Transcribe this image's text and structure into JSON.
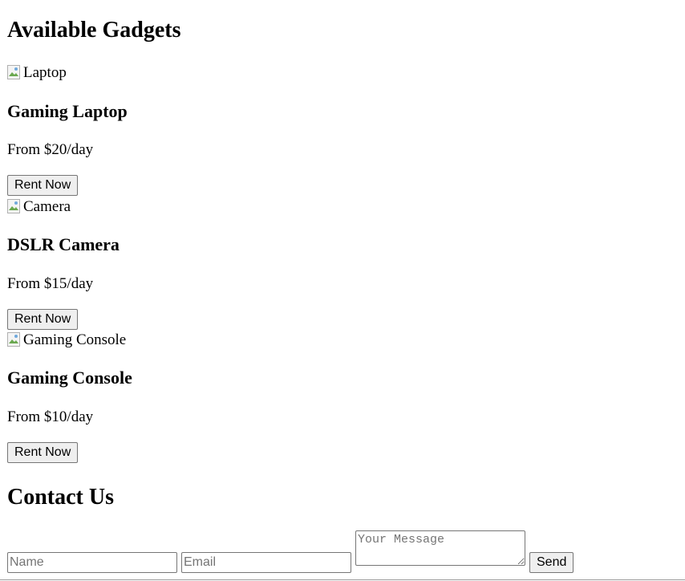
{
  "gadgets_section": {
    "title": "Available Gadgets",
    "items": [
      {
        "image_alt": "Laptop",
        "name": "Gaming Laptop",
        "price": "From $20/day",
        "button_label": "Rent Now"
      },
      {
        "image_alt": "Camera",
        "name": "DSLR Camera",
        "price": "From $15/day",
        "button_label": "Rent Now"
      },
      {
        "image_alt": "Gaming Console",
        "name": "Gaming Console",
        "price": "From $10/day",
        "button_label": "Rent Now"
      }
    ]
  },
  "contact_section": {
    "title": "Contact Us",
    "name_placeholder": "Name",
    "email_placeholder": "Email",
    "message_placeholder": "Your Message",
    "send_label": "Send"
  },
  "icons": {
    "broken_image": "broken-image-icon"
  }
}
